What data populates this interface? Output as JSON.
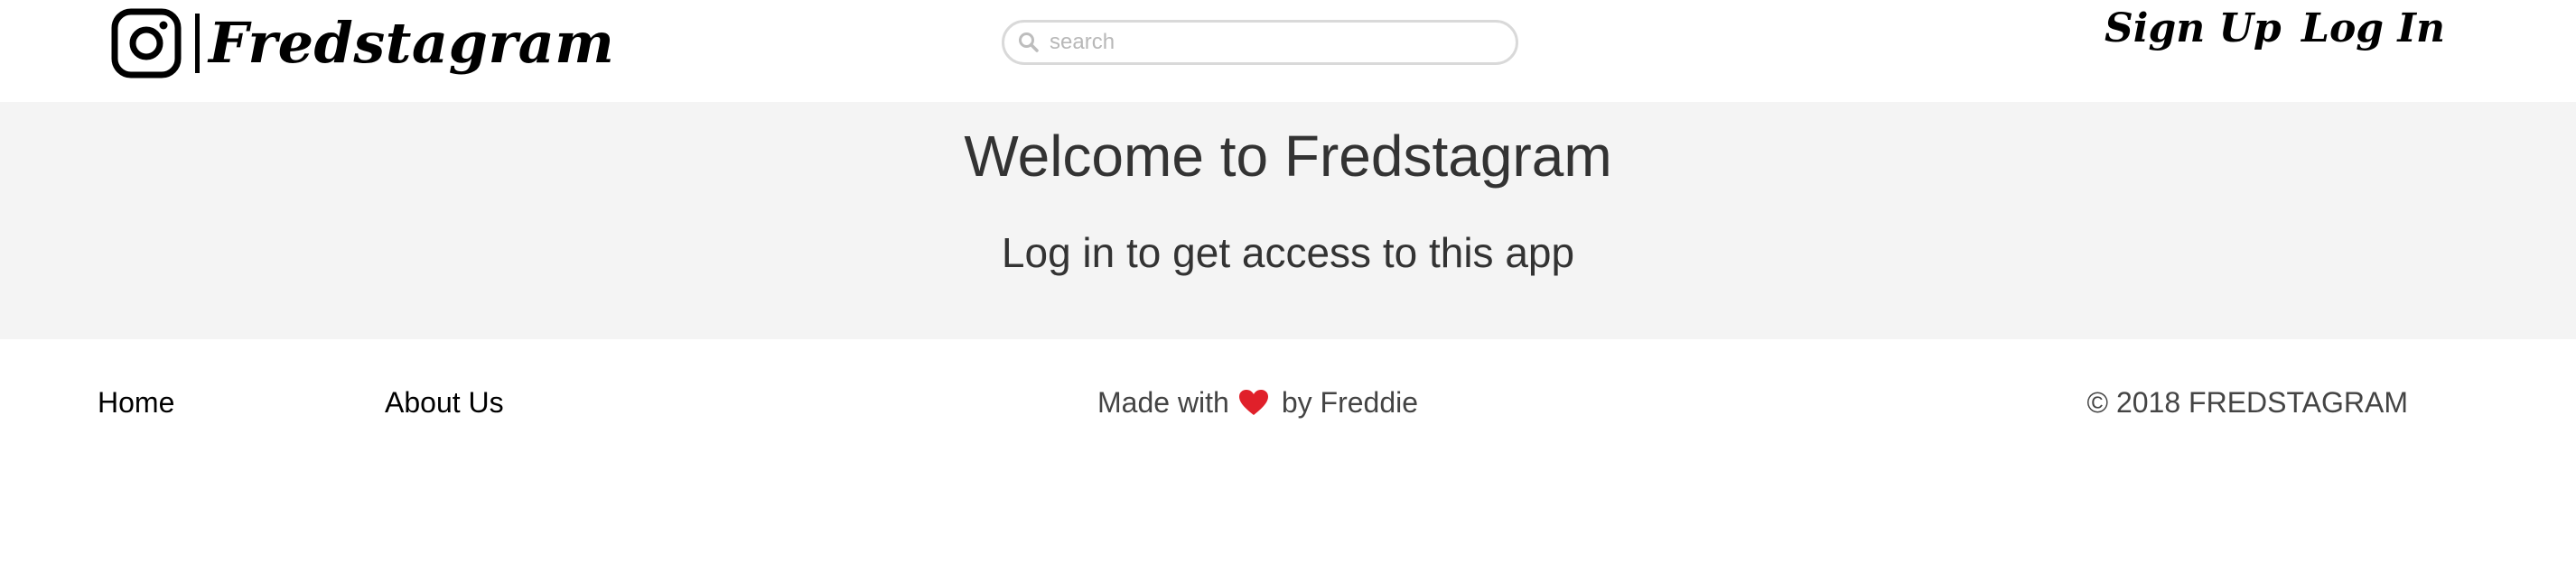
{
  "header": {
    "logo_icon": "instagram-camera-icon",
    "brand": "Fredstagram",
    "search": {
      "icon": "search-icon",
      "placeholder": "search",
      "value": ""
    },
    "nav": {
      "signup": "Sign Up",
      "login": "Log In"
    }
  },
  "hero": {
    "title": "Welcome to Fredstagram",
    "subtitle": "Log in to get access to this app"
  },
  "footer": {
    "home": "Home",
    "about": "About Us",
    "made_with_prefix": "Made with",
    "heart_icon": "heart-icon",
    "made_with_suffix": "by Freddie",
    "copyright": "© 2018 FREDSTAGRAM"
  },
  "colors": {
    "hero_bg": "#f4f4f4",
    "text_dark": "#333333",
    "heart": "#e0202a",
    "search_border": "#d9d9d9"
  }
}
